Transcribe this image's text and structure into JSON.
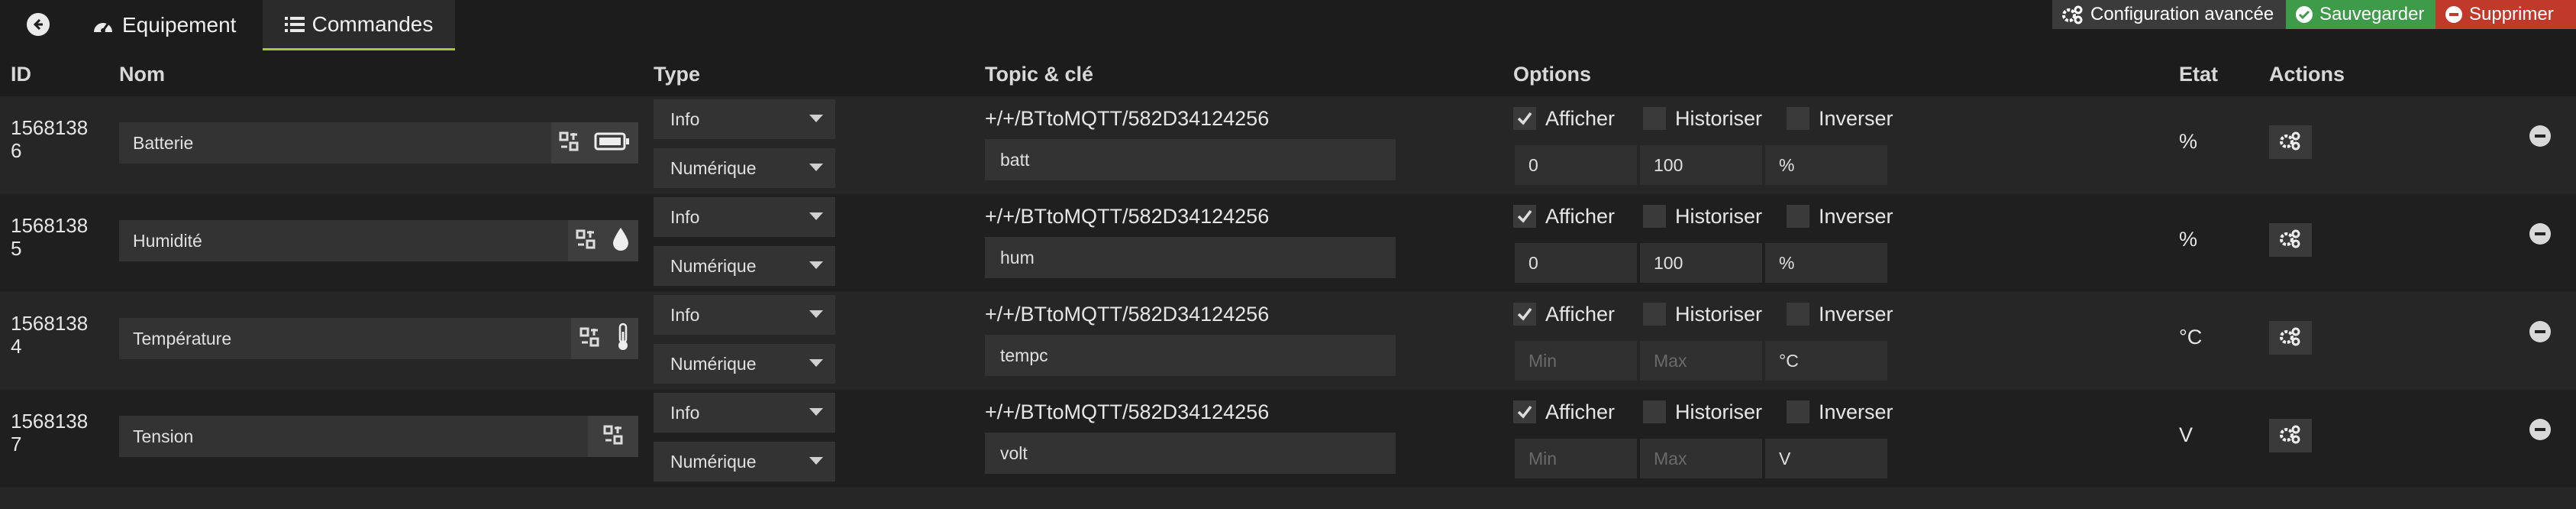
{
  "tabs": {
    "equipement": "Equipement",
    "commandes": "Commandes"
  },
  "toolbar": {
    "config": "Configuration avancée",
    "save": "Sauvegarder",
    "delete": "Supprimer"
  },
  "columns": {
    "id": "ID",
    "nom": "Nom",
    "type": "Type",
    "topic": "Topic & clé",
    "options": "Options",
    "etat": "Etat",
    "actions": "Actions"
  },
  "option_labels": {
    "afficher": "Afficher",
    "historiser": "Historiser",
    "inverser": "Inverser"
  },
  "rows": [
    {
      "id_line1": "1568138",
      "id_line2": "6",
      "name": "Batterie",
      "type": "Info",
      "subtype": "Numérique",
      "topic": "+/+/BTtoMQTT/582D34124256",
      "key": "batt",
      "afficher": true,
      "historiser": false,
      "inverser": false,
      "min": "0",
      "max": "100",
      "unit": "%",
      "etat": "%",
      "icons": [
        "generic-cmd-icon",
        "battery-icon"
      ]
    },
    {
      "id_line1": "1568138",
      "id_line2": "5",
      "name": "Humidité",
      "type": "Info",
      "subtype": "Numérique",
      "topic": "+/+/BTtoMQTT/582D34124256",
      "key": "hum",
      "afficher": true,
      "historiser": false,
      "inverser": false,
      "min": "0",
      "max": "100",
      "unit": "%",
      "etat": "%",
      "icons": [
        "generic-cmd-icon",
        "water-drop-icon"
      ]
    },
    {
      "id_line1": "1568138",
      "id_line2": "4",
      "name": "Température",
      "type": "Info",
      "subtype": "Numérique",
      "topic": "+/+/BTtoMQTT/582D34124256",
      "key": "tempc",
      "afficher": true,
      "historiser": false,
      "inverser": false,
      "min_placeholder": "Min",
      "max_placeholder": "Max",
      "unit": "°C",
      "etat": "°C",
      "icons": [
        "generic-cmd-icon",
        "thermometer-icon"
      ]
    },
    {
      "id_line1": "1568138",
      "id_line2": "7",
      "name": "Tension",
      "type": "Info",
      "subtype": "Numérique",
      "topic": "+/+/BTtoMQTT/582D34124256",
      "key": "volt",
      "afficher": true,
      "historiser": false,
      "inverser": false,
      "min_placeholder": "Min",
      "max_placeholder": "Max",
      "unit": "V",
      "etat": "V",
      "icons": [
        "generic-cmd-icon"
      ]
    }
  ],
  "colors": {
    "accent": "#a8c830",
    "save": "#3d9b4a",
    "delete": "#c0392b"
  }
}
